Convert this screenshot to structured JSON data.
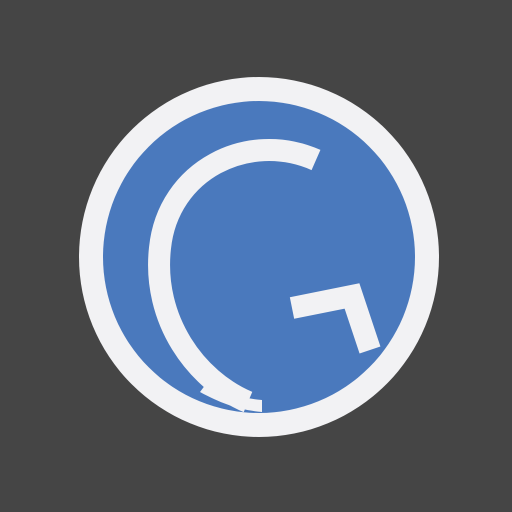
{
  "icon": {
    "name": "g-letter-app-icon",
    "colors": {
      "background": "#454545",
      "ring": "#f2f2f4",
      "disc": "#4a79bd",
      "glyph": "#f2f2f4"
    }
  }
}
